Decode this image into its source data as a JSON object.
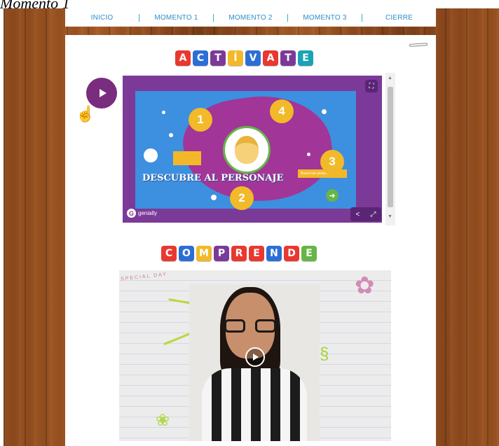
{
  "caption": "Momento 1",
  "nav": {
    "items": [
      "INICIO",
      "MOMENTO 1",
      "MOMENTO 2",
      "MOMENTO 3",
      "CIERRE"
    ]
  },
  "section1": {
    "letters": [
      "A",
      "C",
      "T",
      "Í",
      "V",
      "A",
      "T",
      "E"
    ],
    "colors": [
      "#e8382f",
      "#2b6fd6",
      "#7b3a98",
      "#f2b928",
      "#2b6fd6",
      "#e8382f",
      "#7b3a98",
      "#1aa3b5"
    ]
  },
  "genially": {
    "numbers": [
      "1",
      "4",
      "3",
      "2"
    ],
    "descubre": "DESCUBRE AL PERSONAJE",
    "busca": "Busca las pistas...",
    "logo_text": "genially",
    "logo_letter": "G"
  },
  "section2": {
    "letters": [
      "C",
      "O",
      "M",
      "P",
      "R",
      "E",
      "N",
      "D",
      "E"
    ],
    "colors": [
      "#e8382f",
      "#2b6fd6",
      "#f2b928",
      "#7b3a98",
      "#e8382f",
      "#e8382f",
      "#2b6fd6",
      "#e8382f",
      "#66b547"
    ]
  },
  "video": {
    "doodle_text": "SPECIAL DAY"
  }
}
